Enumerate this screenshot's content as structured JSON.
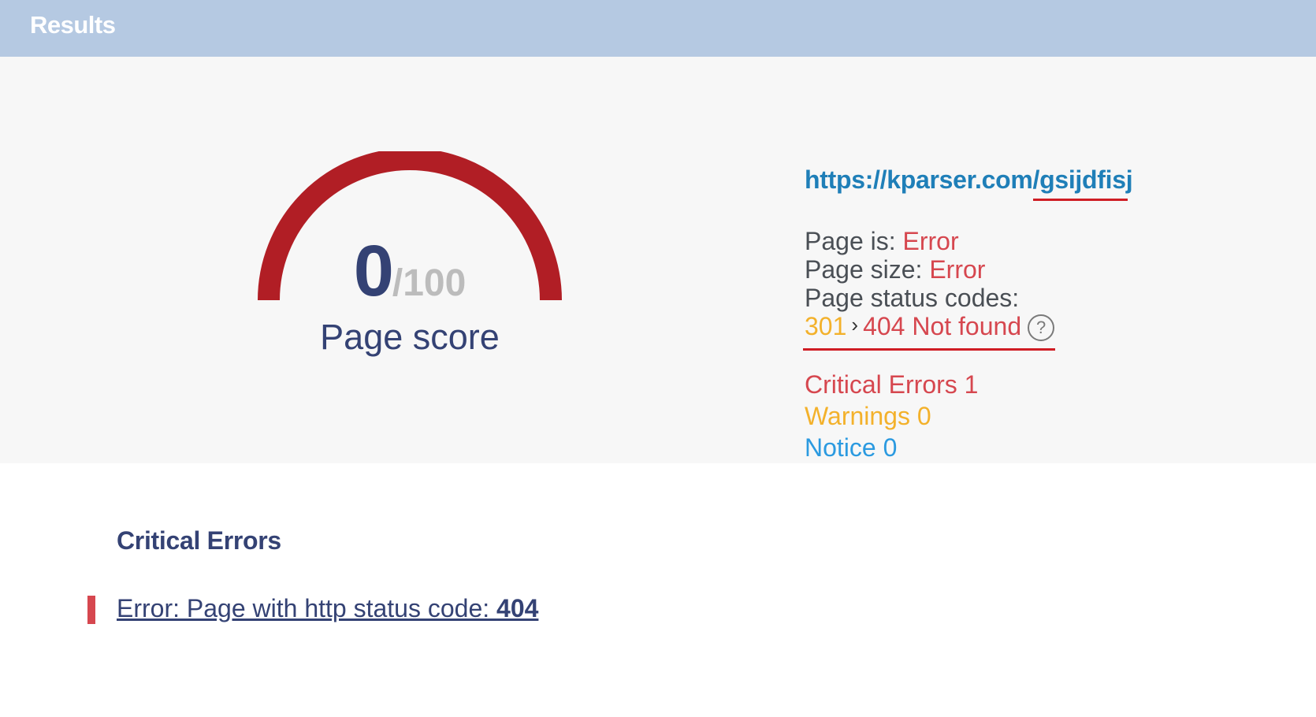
{
  "header": {
    "title": "Results",
    "background_color": "#b5c9e2"
  },
  "score": {
    "value": "0",
    "max_text": "/100",
    "label": "Page score",
    "fraction": 0,
    "gauge_color": "#b11e25"
  },
  "page_info": {
    "url": "https://kparser.com/gsijdfisj",
    "page_is_label": "Page is:",
    "page_is_value": "Error",
    "page_size_label": "Page size:",
    "page_size_value": "Error",
    "status_codes_label": "Page status codes:",
    "status_redirect": "301",
    "status_final": "404 Not found",
    "help_icon": "question-circle-icon",
    "arrow_icon": "chevron-right-icon"
  },
  "counts": {
    "critical": "Critical Errors 1",
    "warnings": "Warnings 0",
    "notice": "Notice 0"
  },
  "critical_errors": {
    "title": "Critical Errors",
    "items": [
      {
        "text": "Error: Page with http status code: ",
        "code": "404"
      }
    ]
  },
  "colors": {
    "error": "#d6474f",
    "warning": "#f3b12b",
    "notice": "#2b9ae0",
    "link": "#1f7fb8",
    "navy": "#344274"
  }
}
